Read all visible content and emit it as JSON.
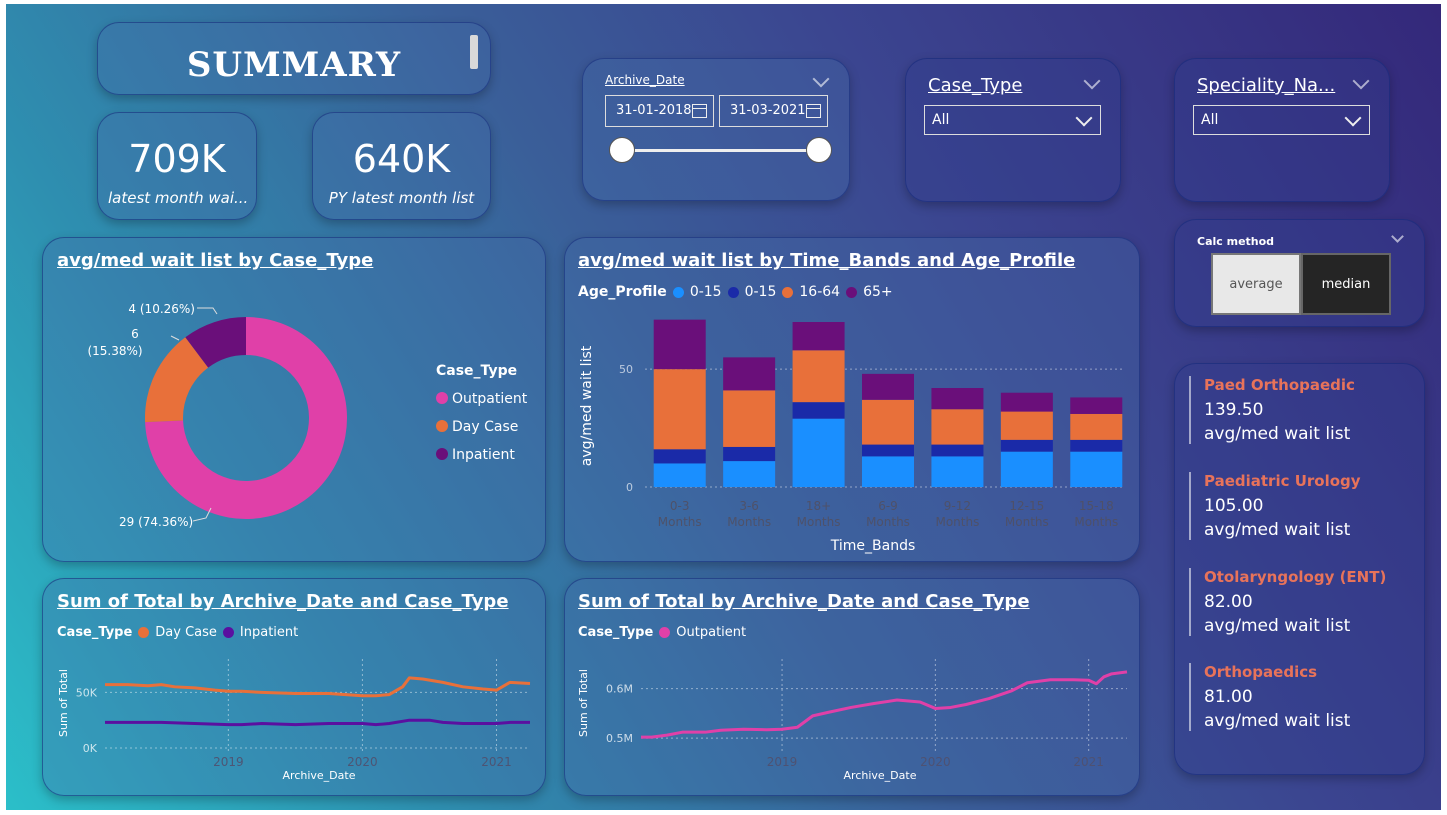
{
  "summary": {
    "title": "SUMMARY"
  },
  "kpis": [
    {
      "value": "709K",
      "label": "latest month wai..."
    },
    {
      "value": "640K",
      "label": "PY latest month list"
    }
  ],
  "archive_date": {
    "title": "Archive_Date",
    "start": "31-01-2018",
    "end": "31-03-2021"
  },
  "case_type_slicer": {
    "title": "Case_Type",
    "value": "All"
  },
  "speciality_slicer": {
    "title": "Speciality_Na...",
    "value": "All"
  },
  "calc_method": {
    "title": "Calc method",
    "options": [
      "average",
      "median"
    ],
    "selected": "average"
  },
  "specialities": [
    {
      "name": "Paed Orthopaedic",
      "value": "139.50",
      "label": "avg/med wait list"
    },
    {
      "name": "Paediatric Urology",
      "value": "105.00",
      "label": "avg/med wait list"
    },
    {
      "name": "Otolaryngology (ENT)",
      "value": "82.00",
      "label": "avg/med wait list"
    },
    {
      "name": "Orthopaedics",
      "value": "81.00",
      "label": "avg/med wait list"
    }
  ],
  "chart_data": [
    {
      "type": "pie",
      "title": "avg/med wait list by Case_Type",
      "legend_title": "Case_Type",
      "legend_position": "right",
      "slices": [
        {
          "name": "Outpatient",
          "value": 29,
          "label": "29 (74.36%)",
          "color": "#e040a8"
        },
        {
          "name": "Day Case",
          "value": 6,
          "label": "6 (15.38%)",
          "color": "#e8703a"
        },
        {
          "name": "Inpatient",
          "value": 4,
          "label": "4 (10.26%)",
          "color": "#6a0f7a"
        }
      ]
    },
    {
      "type": "bar",
      "stacked": true,
      "title": "avg/med wait list by Time_Bands and Age_Profile",
      "legend_title": "Age_Profile",
      "legend_position": "top-left",
      "xlabel": "Time_Bands",
      "ylabel": "avg/med wait list",
      "ylim": [
        0,
        70
      ],
      "yticks": [
        0,
        50
      ],
      "categories": [
        [
          "0-3",
          "Months"
        ],
        [
          "3-6",
          "Months"
        ],
        [
          "18+",
          "Months"
        ],
        [
          "6-9",
          "Months"
        ],
        [
          "9-12",
          "Months"
        ],
        [
          "12-15",
          "Months"
        ],
        [
          "15-18",
          "Months"
        ]
      ],
      "series": [
        {
          "name": "0-15",
          "color": "#1a8fff",
          "values": [
            10,
            11,
            29,
            13,
            13,
            15,
            15
          ]
        },
        {
          "name": "0-15",
          "color": "#1a2aa8",
          "values": [
            6,
            6,
            7,
            5,
            5,
            5,
            5
          ]
        },
        {
          "name": "16-64",
          "color": "#e8703a",
          "values": [
            34,
            24,
            22,
            19,
            15,
            12,
            11
          ]
        },
        {
          "name": "65+",
          "color": "#6a0f7a",
          "values": [
            21,
            14,
            12,
            11,
            9,
            8,
            7
          ]
        }
      ]
    },
    {
      "type": "line",
      "title": "Sum of Total by Archive_Date and Case_Type",
      "legend_title": "Case_Type",
      "legend_position": "top-left",
      "xlabel": "Archive_Date",
      "ylabel": "Sum of Total",
      "ylim": [
        0,
        80000
      ],
      "yticks": [
        [
          0,
          "0K"
        ],
        [
          50000,
          "50K"
        ]
      ],
      "xlim": [
        2018.08,
        2021.25
      ],
      "xticks": [
        2019,
        2020,
        2021
      ],
      "series": [
        {
          "name": "Day Case",
          "color": "#e8703a",
          "x": [
            2018.08,
            2018.25,
            2018.4,
            2018.5,
            2018.6,
            2018.75,
            2018.9,
            2019.0,
            2019.1,
            2019.25,
            2019.5,
            2019.75,
            2020.0,
            2020.1,
            2020.2,
            2020.3,
            2020.35,
            2020.45,
            2020.6,
            2020.75,
            2020.9,
            2021.0,
            2021.1,
            2021.25
          ],
          "y": [
            57000,
            57000,
            56000,
            57000,
            55000,
            54000,
            52000,
            51000,
            51000,
            50000,
            49000,
            49000,
            47000,
            47000,
            48000,
            55000,
            63000,
            62000,
            59000,
            55000,
            53000,
            52000,
            59000,
            58000
          ]
        },
        {
          "name": "Inpatient",
          "color": "#5a10a0",
          "x": [
            2018.08,
            2018.25,
            2018.5,
            2018.75,
            2019.0,
            2019.1,
            2019.25,
            2019.5,
            2019.75,
            2020.0,
            2020.1,
            2020.2,
            2020.35,
            2020.5,
            2020.6,
            2020.75,
            2020.9,
            2021.0,
            2021.1,
            2021.25
          ],
          "y": [
            23000,
            23000,
            23000,
            22000,
            21000,
            21000,
            22000,
            21000,
            22000,
            22000,
            21000,
            22000,
            25000,
            25000,
            23000,
            22000,
            22000,
            22000,
            23000,
            23000
          ]
        }
      ]
    },
    {
      "type": "line",
      "title": "Sum of Total by Archive_Date and Case_Type",
      "legend_title": "Case_Type",
      "legend_position": "top-left",
      "xlabel": "Archive_Date",
      "ylabel": "Sum of Total",
      "ylim": [
        480000,
        660000
      ],
      "yticks": [
        [
          500000,
          "0.5M"
        ],
        [
          600000,
          "0.6M"
        ]
      ],
      "xlim": [
        2018.08,
        2021.25
      ],
      "xticks": [
        2019,
        2020,
        2021
      ],
      "series": [
        {
          "name": "Outpatient",
          "color": "#e040a8",
          "x": [
            2018.08,
            2018.15,
            2018.25,
            2018.35,
            2018.5,
            2018.6,
            2018.75,
            2018.9,
            2019.0,
            2019.1,
            2019.2,
            2019.3,
            2019.45,
            2019.6,
            2019.75,
            2019.9,
            2020.0,
            2020.1,
            2020.2,
            2020.35,
            2020.5,
            2020.6,
            2020.75,
            2020.9,
            2021.0,
            2021.05,
            2021.1,
            2021.15,
            2021.25
          ],
          "y": [
            502000,
            502000,
            506000,
            512000,
            512000,
            516000,
            518000,
            517000,
            518000,
            522000,
            545000,
            552000,
            562000,
            570000,
            577000,
            573000,
            560000,
            562000,
            568000,
            580000,
            596000,
            612000,
            618000,
            618000,
            617000,
            610000,
            624000,
            630000,
            634000
          ]
        }
      ]
    }
  ]
}
